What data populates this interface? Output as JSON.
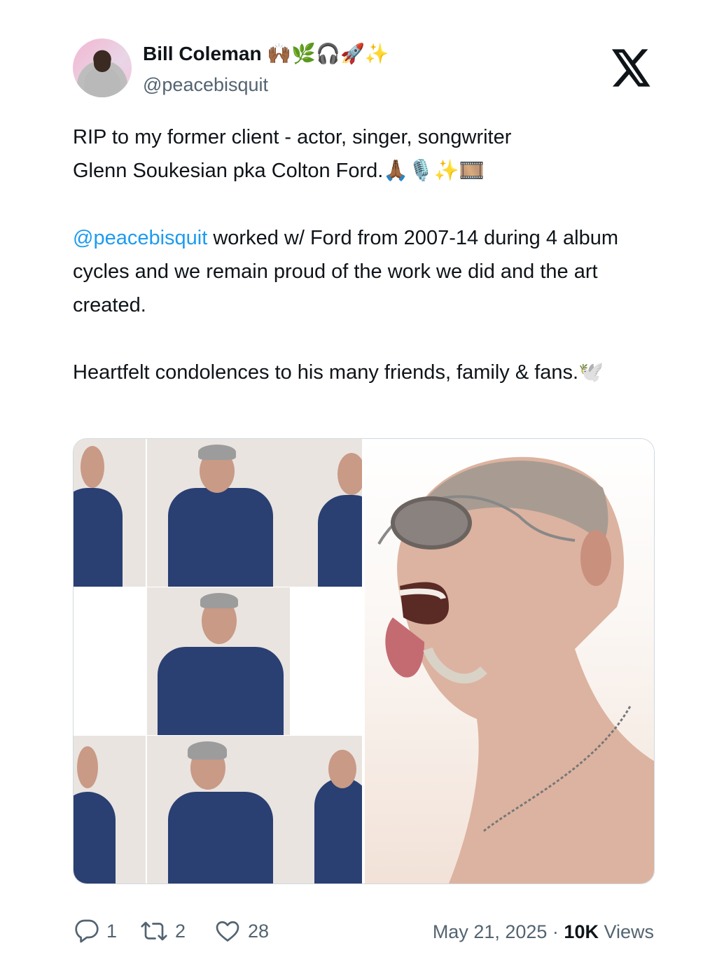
{
  "author": {
    "name": "Bill Coleman 🙌🏾🌿🎧🚀✨",
    "handle": "@peacebisquit"
  },
  "tweet": {
    "line1": "RIP to my former client - actor, singer, songwriter",
    "line2": "Glenn Soukesian pka Colton Ford.🙏🏾🎙️✨🎞️",
    "mention": "@peacebisquit",
    "para2_rest": " worked w/ Ford from 2007-14 during 4 album cycles and we remain proud of the work we did and the art created.",
    "para3": "Heartfelt condolences to his many friends, family & fans.🕊️"
  },
  "stats": {
    "replies": "1",
    "reposts": "2",
    "likes": "28",
    "date": "May 21, 2025",
    "separator": " · ",
    "views_count": "10K",
    "views_label": " Views"
  },
  "icons": {
    "logo": "x-logo-icon",
    "reply": "reply-icon",
    "repost": "repost-icon",
    "like": "heart-icon"
  }
}
